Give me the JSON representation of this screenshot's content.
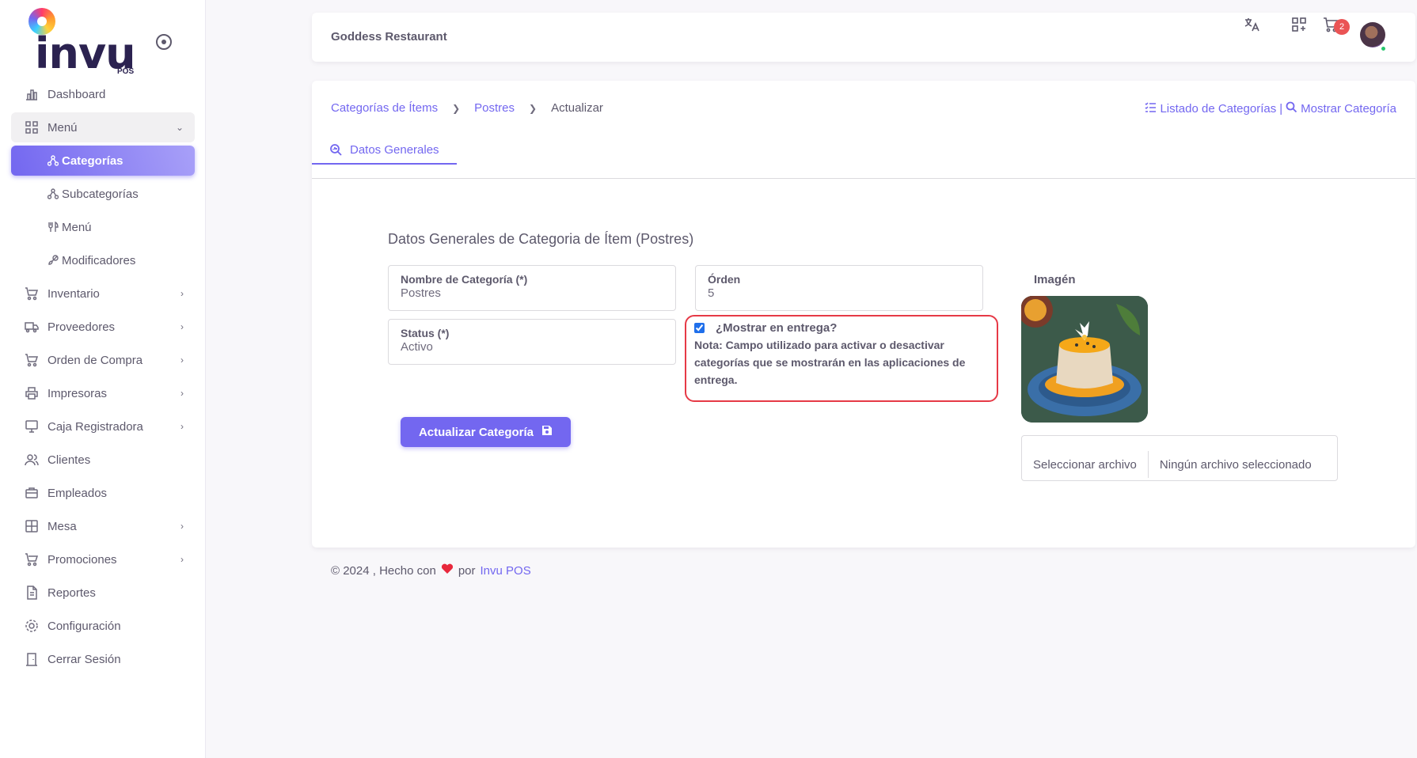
{
  "brand": {
    "logo_text": "invu",
    "logo_sub": "POS"
  },
  "header": {
    "restaurant": "Goddess Restaurant",
    "cart_count": "2"
  },
  "sidebar": {
    "items": [
      {
        "label": "Dashboard",
        "icon": "bar-chart-icon"
      },
      {
        "label": "Menú",
        "icon": "grid-icon"
      },
      {
        "label": "Inventario",
        "icon": "cart-icon"
      },
      {
        "label": "Proveedores",
        "icon": "truck-icon"
      },
      {
        "label": "Orden de Compra",
        "icon": "cart-icon"
      },
      {
        "label": "Impresoras",
        "icon": "printer-icon"
      },
      {
        "label": "Caja Registradora",
        "icon": "register-icon"
      },
      {
        "label": "Clientes",
        "icon": "users-icon"
      },
      {
        "label": "Empleados",
        "icon": "briefcase-icon"
      },
      {
        "label": "Mesa",
        "icon": "table-icon"
      },
      {
        "label": "Promociones",
        "icon": "cart-icon"
      },
      {
        "label": "Reportes",
        "icon": "file-icon"
      },
      {
        "label": "Configuración",
        "icon": "gear-icon"
      },
      {
        "label": "Cerrar Sesión",
        "icon": "door-icon"
      }
    ],
    "submenu": [
      {
        "label": "Categorías"
      },
      {
        "label": "Subcategorías"
      },
      {
        "label": "Menú"
      },
      {
        "label": "Modificadores"
      }
    ]
  },
  "breadcrumb": {
    "item1": "Categorías de Ítems",
    "item2": "Postres",
    "current": "Actualizar"
  },
  "actions": {
    "list": "Listado de Categorías",
    "divider": "|",
    "show": "Mostrar Categoría"
  },
  "tabs": {
    "general": "Datos Generales"
  },
  "form": {
    "title": "Datos Generales de Categoria de Ítem (Postres)",
    "name_label": "Nombre de Categoría (*)",
    "name_value": "Postres",
    "order_label": "Órden",
    "order_value": "5",
    "status_label": "Status (*)",
    "status_value": "Activo",
    "delivery_question": "¿Mostrar en entrega?",
    "delivery_note": "Nota: Campo utilizado para activar o desactivar categorías que se mostrarán en las aplicaciones de entrega.",
    "image_label": "Imagén",
    "file_button": "Seleccionar archivo",
    "file_name": "Ningún archivo seleccionado",
    "submit": "Actualizar Categoría"
  },
  "footer": {
    "text": "© 2024 , Hecho con",
    "by": "por",
    "link": "Invu POS"
  },
  "colors": {
    "primary": "#7367f0",
    "danger": "#ea5455",
    "highlight": "#e63946"
  }
}
